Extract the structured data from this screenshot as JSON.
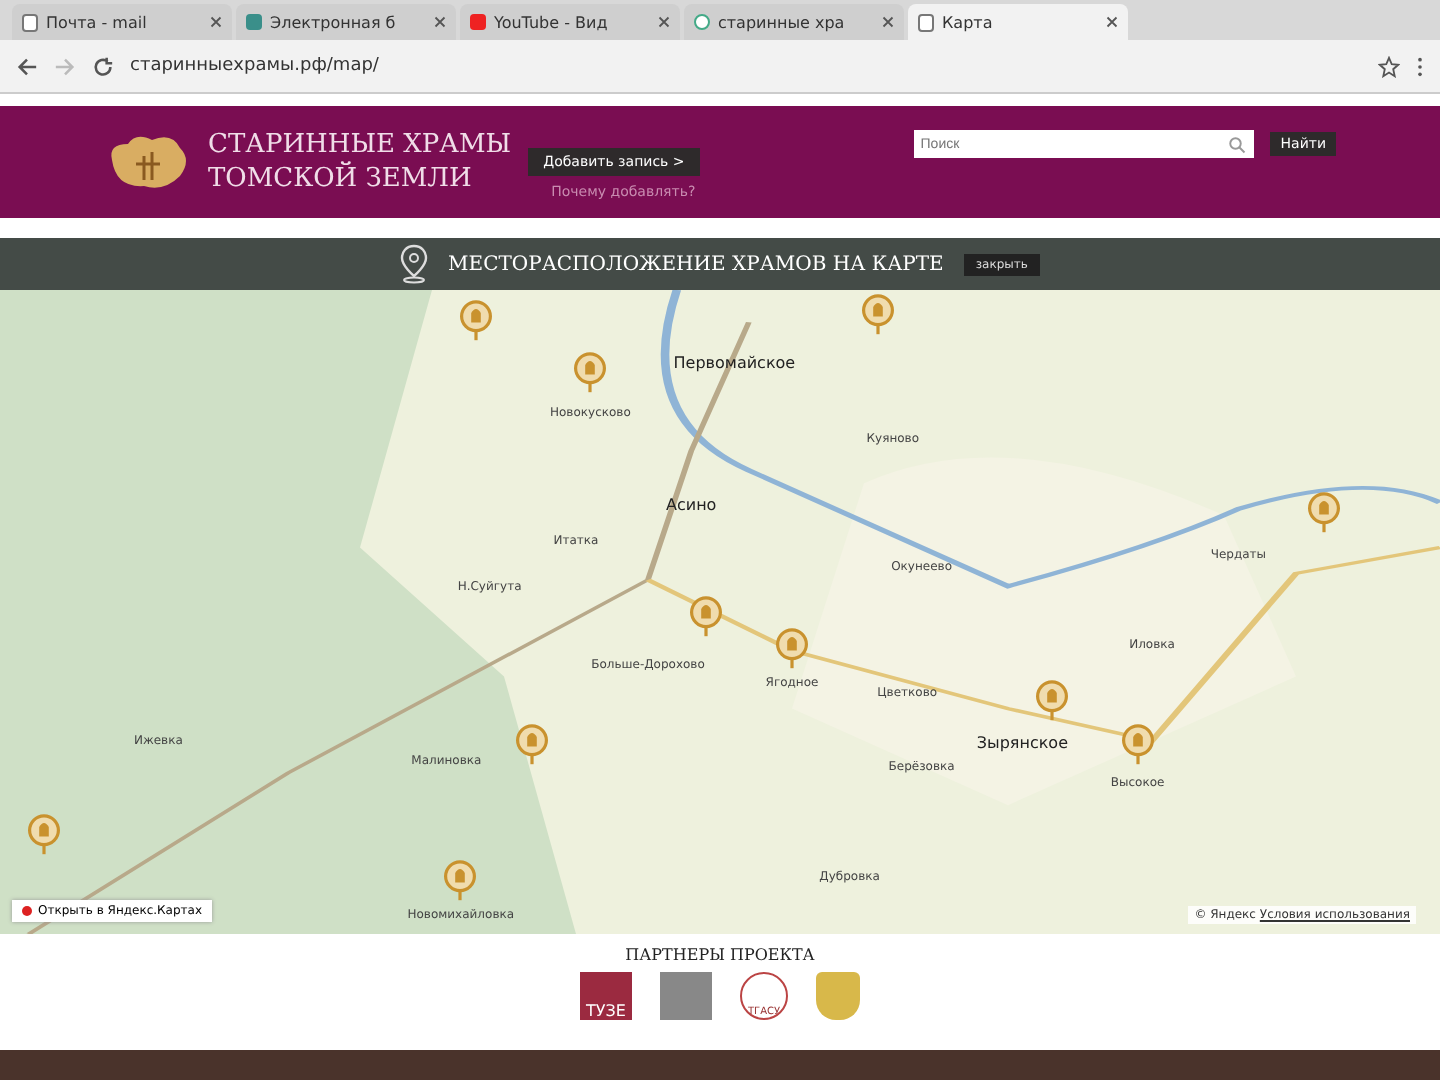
{
  "browser": {
    "tabs": [
      {
        "title": "Почта - mail",
        "selected": false,
        "kind": "page"
      },
      {
        "title": "Электронная б",
        "selected": false,
        "kind": "doc"
      },
      {
        "title": "YouTube - Вид",
        "selected": false,
        "kind": "video"
      },
      {
        "title": "старинные хра",
        "selected": false,
        "kind": "search"
      },
      {
        "title": "Карта",
        "selected": true,
        "kind": "page"
      }
    ],
    "url": "старинныехрамы.рф/map/"
  },
  "header": {
    "logo_lines": [
      "СТАРИННЫЕ ХРАМЫ",
      "ТОМСКОЙ ЗЕМЛИ"
    ],
    "add_button": "Добавить запись >",
    "add_hint": "Почему добавлять?",
    "search": {
      "placeholder": "Поиск"
    },
    "search_button": "Найти"
  },
  "section_bar": {
    "title": "МЕСТОРАСПОЛОЖЕНИЕ ХРАМОВ НА КАРТЕ",
    "button": "закрыть"
  },
  "map": {
    "places": [
      {
        "name": "Первомайское",
        "big": true
      },
      {
        "name": "Новокусково",
        "big": false
      },
      {
        "name": "Куяново",
        "big": false
      },
      {
        "name": "Асино",
        "big": true
      },
      {
        "name": "Итатка",
        "big": false
      },
      {
        "name": "Чердаты",
        "big": false
      },
      {
        "name": "Окунеево",
        "big": false
      },
      {
        "name": "Н.Суйгута",
        "big": false
      },
      {
        "name": "Иловка",
        "big": false
      },
      {
        "name": "Больше-Дорохово",
        "big": false
      },
      {
        "name": "Ягодное",
        "big": false
      },
      {
        "name": "Цветково",
        "big": false
      },
      {
        "name": "Ижевка",
        "big": false
      },
      {
        "name": "Зырянское",
        "big": true
      },
      {
        "name": "Малиновка",
        "big": false
      },
      {
        "name": "Берёзовка",
        "big": false
      },
      {
        "name": "Высокое",
        "big": false
      },
      {
        "name": "Дубровка",
        "big": false
      },
      {
        "name": "Новомихайловка",
        "big": false
      }
    ],
    "open_link": "Открыть в Яндекс.Картах",
    "copyright": "© Яндекс",
    "terms": "Условия использования"
  },
  "partners": {
    "title": "ПАРТНЕРЫ ПРОЕКТА",
    "logos": [
      {
        "text": "ТУЗЕ",
        "kind": "emblem"
      },
      {
        "kind": "photo"
      },
      {
        "text": "ТГАСУ",
        "kind": "circle"
      },
      {
        "kind": "crest"
      }
    ]
  }
}
